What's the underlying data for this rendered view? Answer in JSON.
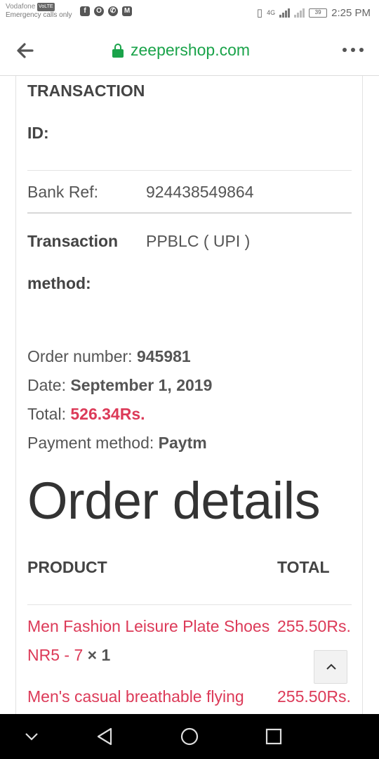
{
  "status_bar": {
    "carrier": "Vodafone",
    "carrier_badge": "VoLTE",
    "emergency_text": "Emergency calls only",
    "app_icons": [
      "facebook-icon",
      "opera-icon",
      "whatsapp-icon",
      "gmail-icon"
    ],
    "network": "4G",
    "battery": "39",
    "time": "2:25 PM"
  },
  "browser": {
    "url": "zeepershop.com",
    "secure": true
  },
  "transaction": {
    "id_label_line1": "TRANSACTION",
    "id_label_line2": "ID:",
    "bank_ref_label": "Bank Ref:",
    "bank_ref_value": "924438549864",
    "method_label_line1": "Transaction",
    "method_label_line2": "method:",
    "method_value": "PPBLC ( UPI )"
  },
  "order_summary": {
    "number_label": "Order number:",
    "number_value": "945981",
    "date_label": "Date:",
    "date_value": "September 1, 2019",
    "total_label": "Total:",
    "total_value": "526.34Rs.",
    "payment_label": "Payment method:",
    "payment_value": "Paytm"
  },
  "order_details": {
    "heading": "Order details",
    "col_product": "PRODUCT",
    "col_total": "TOTAL",
    "items": [
      {
        "name_line1": "Men Fashion Leisure Plate Shoes",
        "name_line2": "NR5 - 7",
        "qty": "× 1",
        "total": "255.50Rs."
      },
      {
        "name_line1": "Men's casual breathable flying",
        "total": "255.50Rs."
      }
    ]
  },
  "colors": {
    "link_red": "#dc3a58",
    "secure_green": "#1aa34a"
  }
}
